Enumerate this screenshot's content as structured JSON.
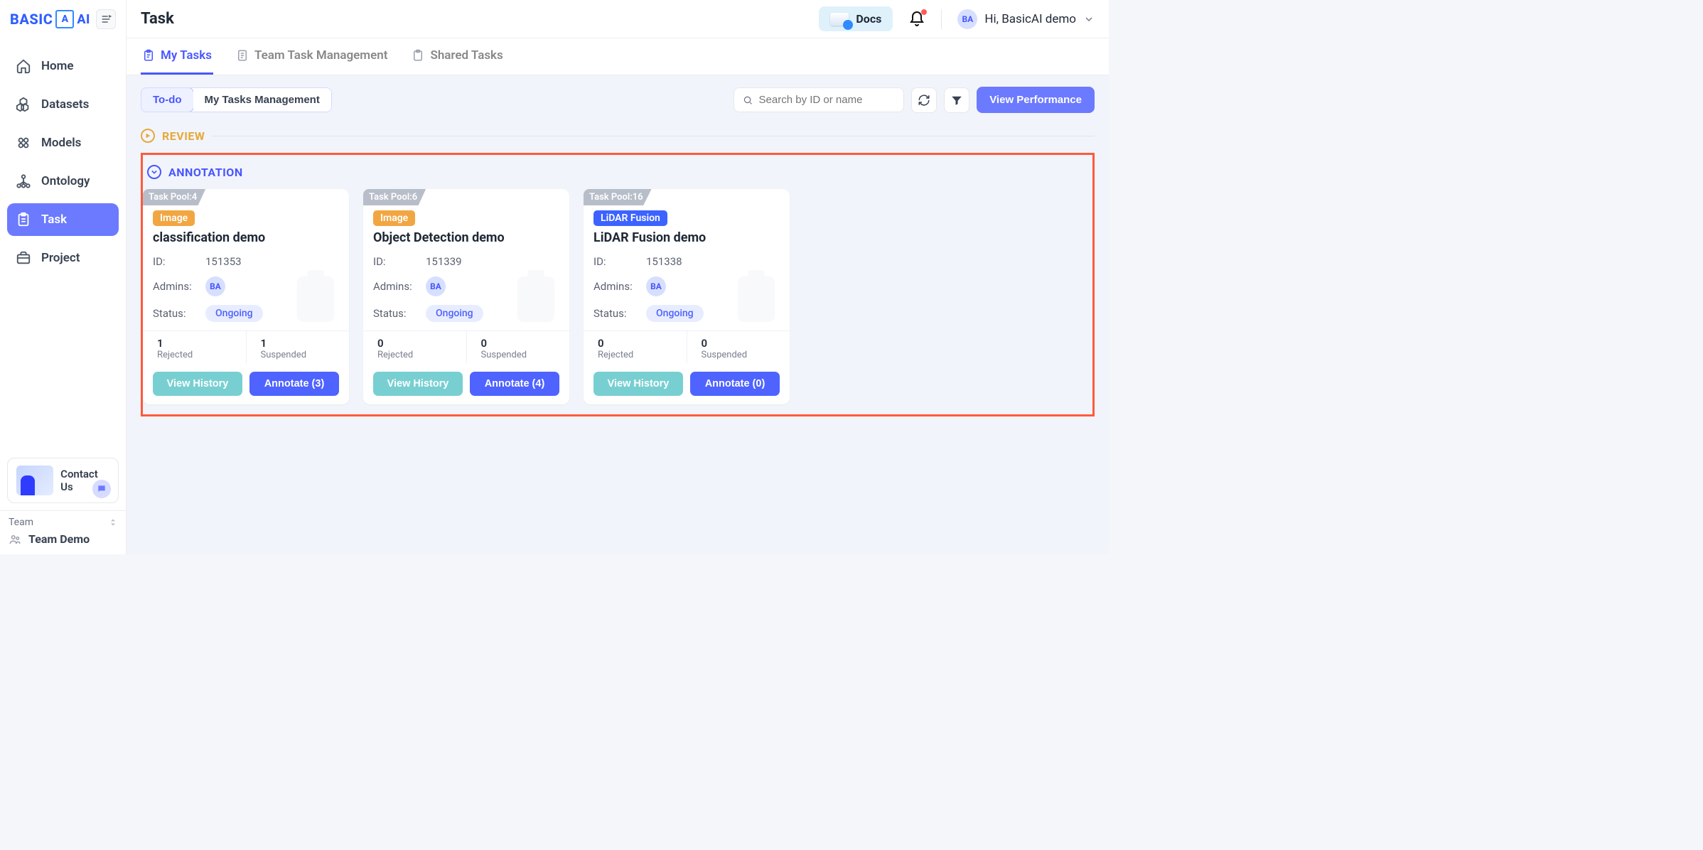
{
  "brand": {
    "name": "BASIC",
    "suffix": "AI",
    "icon_letter": "A"
  },
  "sidebar": {
    "items": [
      {
        "label": "Home"
      },
      {
        "label": "Datasets"
      },
      {
        "label": "Models"
      },
      {
        "label": "Ontology"
      },
      {
        "label": "Task"
      },
      {
        "label": "Project"
      }
    ],
    "contact_label": "Contact Us",
    "team_label": "Team",
    "team_name": "Team Demo"
  },
  "header": {
    "title": "Task",
    "docs_label": "Docs",
    "user_greeting_prefix": "Hi,",
    "user_name": "BasicAI demo",
    "avatar_initials": "BA"
  },
  "tabs": [
    {
      "label": "My Tasks"
    },
    {
      "label": "Team Task Management"
    },
    {
      "label": "Shared Tasks"
    }
  ],
  "toolbar": {
    "seg_todo": "To-do",
    "seg_mgmt": "My Tasks Management",
    "search_placeholder": "Search by ID or name",
    "view_perf": "View Performance"
  },
  "sections": {
    "review": "REVIEW",
    "annotation": "ANNOTATION"
  },
  "cards": [
    {
      "pool": "Task Pool:4",
      "type_label": "Image",
      "type_class": "image",
      "title": "classification demo",
      "id_label": "ID:",
      "id": "151353",
      "admins_label": "Admins:",
      "admin_initials": "BA",
      "status_label": "Status:",
      "status": "Ongoing",
      "rejected": "1",
      "rejected_label": "Rejected",
      "suspended": "1",
      "suspended_label": "Suspended",
      "history_btn": "View History",
      "annotate_btn": "Annotate (3)"
    },
    {
      "pool": "Task Pool:6",
      "type_label": "Image",
      "type_class": "image",
      "title": "Object Detection demo",
      "id_label": "ID:",
      "id": "151339",
      "admins_label": "Admins:",
      "admin_initials": "BA",
      "status_label": "Status:",
      "status": "Ongoing",
      "rejected": "0",
      "rejected_label": "Rejected",
      "suspended": "0",
      "suspended_label": "Suspended",
      "history_btn": "View History",
      "annotate_btn": "Annotate (4)"
    },
    {
      "pool": "Task Pool:16",
      "type_label": "LiDAR Fusion",
      "type_class": "lidar",
      "title": "LiDAR Fusion demo",
      "id_label": "ID:",
      "id": "151338",
      "admins_label": "Admins:",
      "admin_initials": "BA",
      "status_label": "Status:",
      "status": "Ongoing",
      "rejected": "0",
      "rejected_label": "Rejected",
      "suspended": "0",
      "suspended_label": "Suspended",
      "history_btn": "View History",
      "annotate_btn": "Annotate (0)"
    }
  ]
}
